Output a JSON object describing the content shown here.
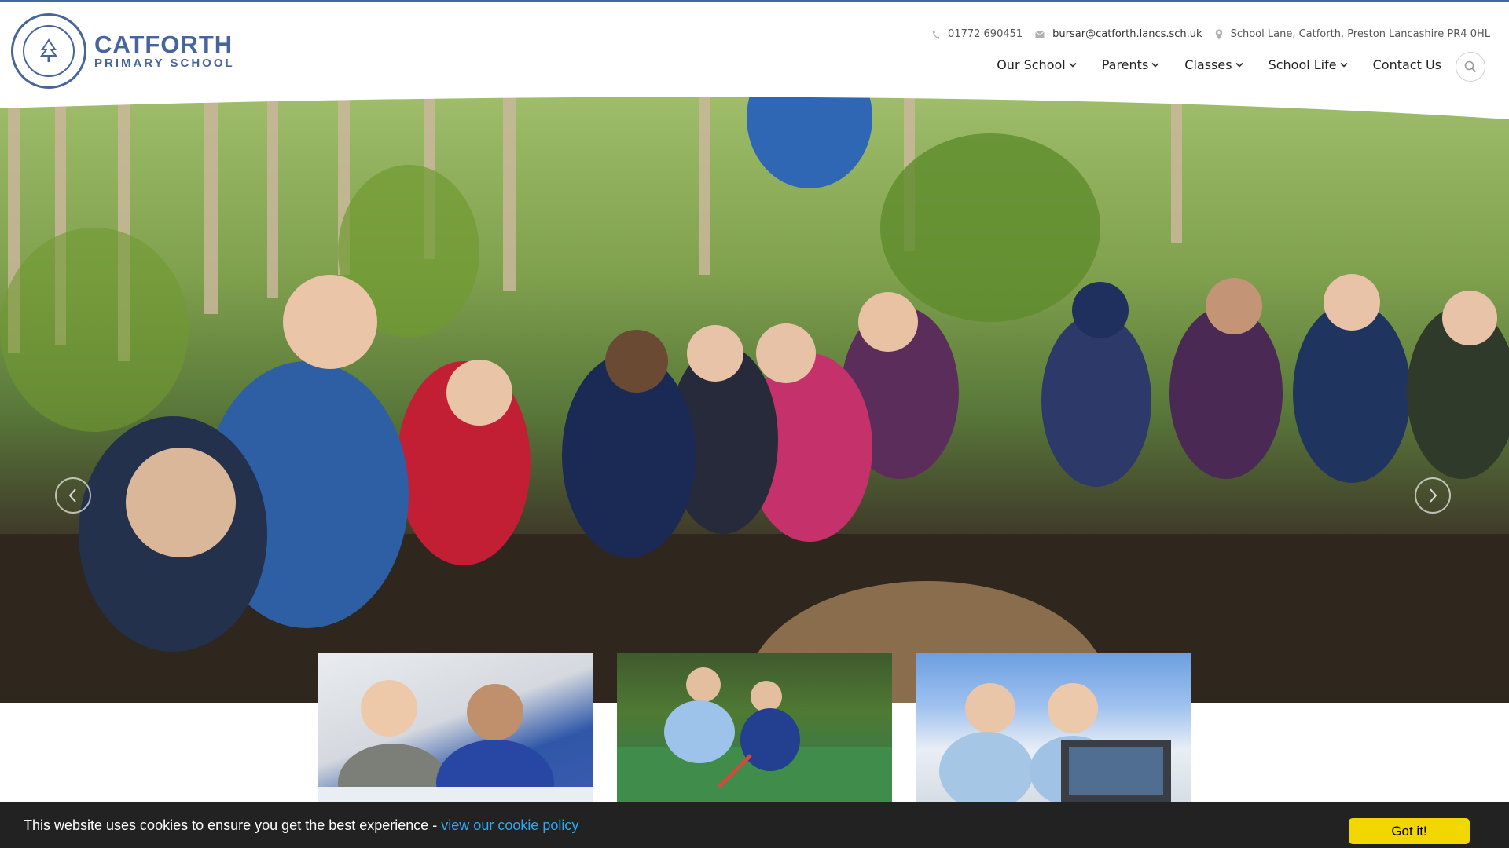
{
  "logo": {
    "name": "CATFORTH",
    "subtitle": "PRIMARY SCHOOL"
  },
  "contact": {
    "phone": "01772 690451",
    "email": "bursar@catforth.lancs.sch.uk",
    "address": "School Lane, Catforth, Preston Lancashire PR4 0HL",
    "phone_icon": "phone-icon",
    "email_icon": "envelope-icon",
    "address_icon": "map-pin-icon"
  },
  "nav": {
    "items": [
      {
        "label": "Our School",
        "has_dropdown": true
      },
      {
        "label": "Parents",
        "has_dropdown": true
      },
      {
        "label": "Classes",
        "has_dropdown": true
      },
      {
        "label": "School Life",
        "has_dropdown": true
      },
      {
        "label": "Contact Us",
        "has_dropdown": false
      }
    ],
    "search_icon": "search-icon"
  },
  "hero": {
    "prev_icon": "chevron-left-icon",
    "next_icon": "chevron-right-icon"
  },
  "cookie": {
    "message": "This website uses cookies to ensure you get the best experience -",
    "link_text": "view our cookie policy",
    "button_label": "Got it!"
  },
  "colors": {
    "brand": "#46659a",
    "top_border": "#3f68a5",
    "cookie_bg": "#222222",
    "cookie_link": "#31a8f0",
    "cookie_button": "#f1d600"
  }
}
